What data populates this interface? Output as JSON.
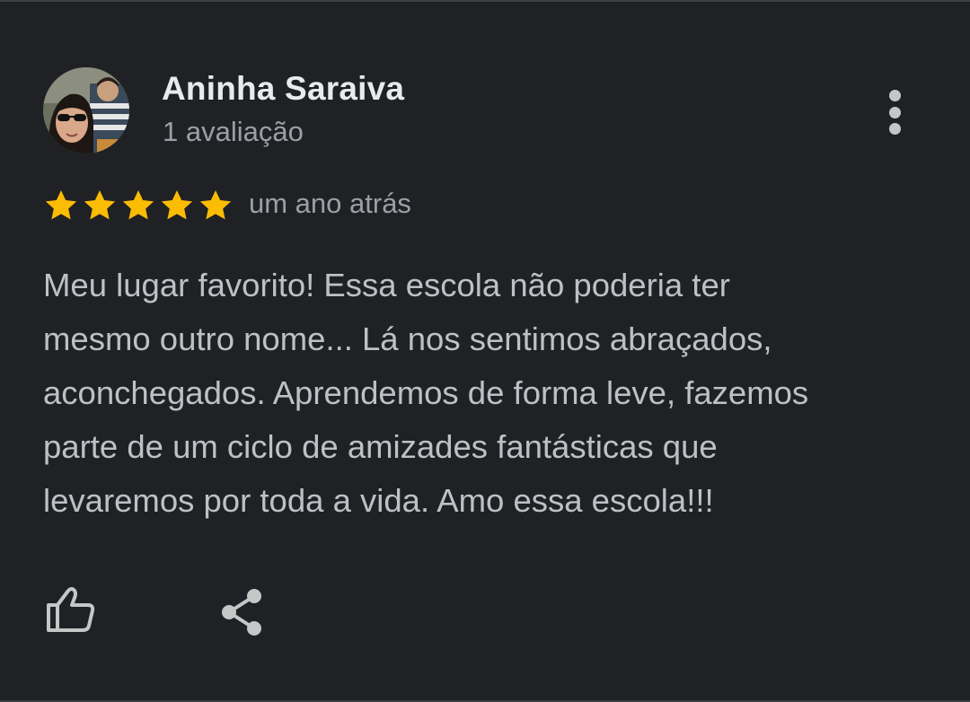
{
  "review": {
    "author_name": "Aninha Saraiva",
    "author_review_count": "1 avaliação",
    "rating": 5,
    "rating_max": 5,
    "time_ago": "um ano atrás",
    "text_lines": [
      "Meu lugar favorito! Essa escola não poderia ter",
      "mesmo outro nome... Lá nos sentimos abraçados,",
      "aconchegados. Aprendemos de forma leve, fazemos",
      "parte de um ciclo de amizades fantásticas que",
      "levaremos por toda a vida. Amo essa escola!!!"
    ]
  },
  "icons": {
    "more": "more-vert-icon",
    "star": "star-icon",
    "like": "thumb-up-icon",
    "share": "share-icon"
  },
  "colors": {
    "background": "#202124",
    "star": "#fbbc04",
    "name": "#e8eaed",
    "secondary_text": "#9aa0a6",
    "body_text": "#bdc1c6"
  }
}
